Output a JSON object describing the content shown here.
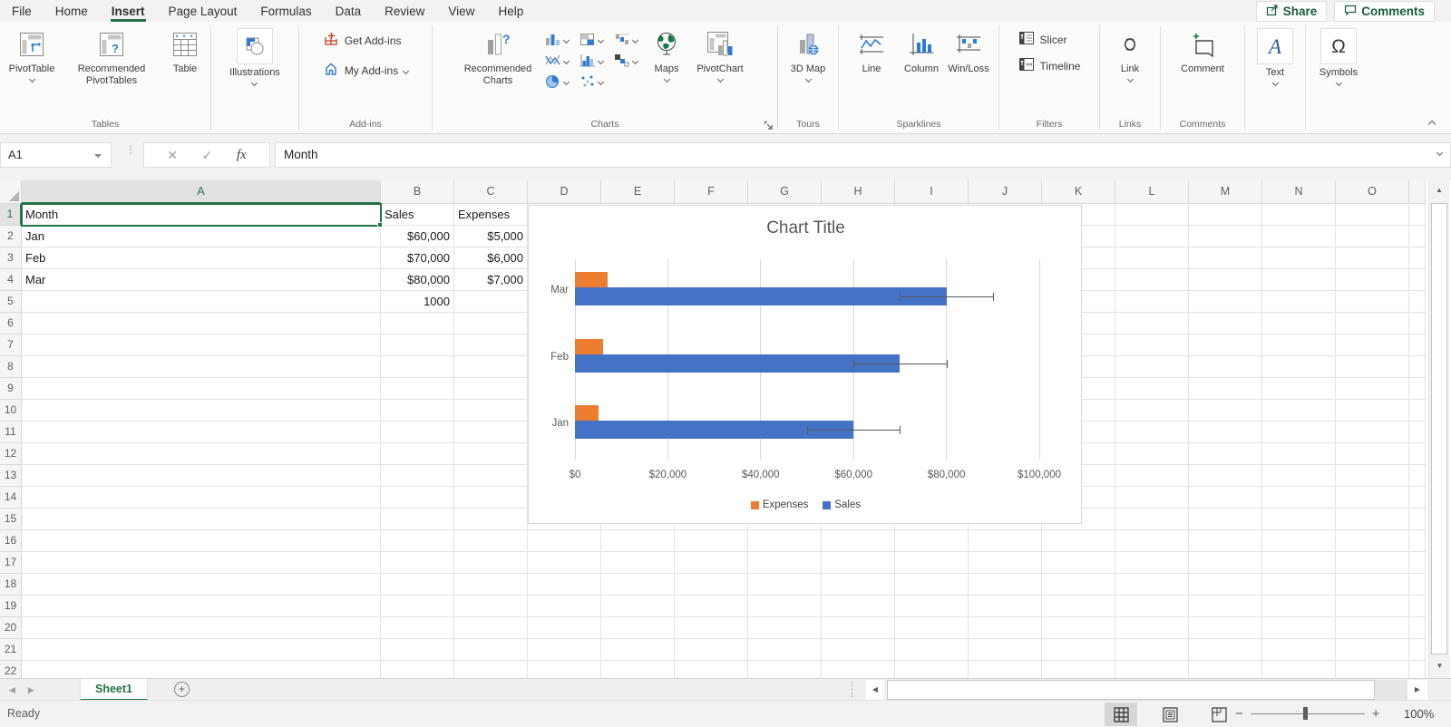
{
  "menu": {
    "tabs": [
      "File",
      "Home",
      "Insert",
      "Page Layout",
      "Formulas",
      "Data",
      "Review",
      "View",
      "Help"
    ],
    "active_tab": "Insert",
    "share": "Share",
    "comments_btn": "Comments",
    "accent_color": "#217346"
  },
  "ribbon": {
    "tables": {
      "caption": "Tables",
      "pivottable": "PivotTable",
      "recommended_pivottables": "Recommended PivotTables",
      "table": "Table"
    },
    "illustrations": {
      "button": "Illustrations"
    },
    "addins": {
      "caption": "Add-ins",
      "get_addins": "Get Add-ins",
      "my_addins": "My Add-ins"
    },
    "charts": {
      "caption": "Charts",
      "recommended_charts": "Recommended Charts",
      "maps": "Maps",
      "pivotchart": "PivotChart"
    },
    "tours": {
      "caption": "Tours",
      "map3d": "3D Map"
    },
    "sparklines": {
      "caption": "Sparklines",
      "line": "Line",
      "column": "Column",
      "winloss": "Win/Loss"
    },
    "filters": {
      "caption": "Filters",
      "slicer": "Slicer",
      "timeline": "Timeline"
    },
    "links": {
      "caption": "Links",
      "link": "Link"
    },
    "comments": {
      "caption": "Comments",
      "comment": "Comment"
    },
    "text": {
      "button": "Text"
    },
    "symbols": {
      "button": "Symbols"
    }
  },
  "formula_bar": {
    "name_box": "A1",
    "fx": "fx",
    "value": "Month"
  },
  "grid": {
    "columns": [
      "A",
      "B",
      "C",
      "D",
      "E",
      "F",
      "G",
      "H",
      "I",
      "J",
      "K",
      "L",
      "M",
      "N",
      "O"
    ],
    "row_numbers": [
      1,
      2,
      3,
      4,
      5,
      6,
      7,
      8,
      9,
      10,
      11,
      12,
      13,
      14,
      15,
      16,
      17,
      18,
      19,
      20,
      21,
      22
    ],
    "selected_cell": "A1",
    "cells": {
      "A1": "Month",
      "B1": "Sales",
      "C1": "Expenses",
      "A2": "Jan",
      "B2": "$60,000",
      "C2": "$5,000",
      "A3": "Feb",
      "B3": "$70,000",
      "C3": "$6,000",
      "A4": "Mar",
      "B4": "$80,000",
      "C4": "$7,000",
      "B5": "1000"
    }
  },
  "chart_data": {
    "type": "bar",
    "orientation": "horizontal",
    "title": "Chart Title",
    "categories": [
      "Jan",
      "Feb",
      "Mar"
    ],
    "category_order_top_to_bottom": [
      "Mar",
      "Feb",
      "Jan"
    ],
    "series": [
      {
        "name": "Sales",
        "color": "#4472C4",
        "values": [
          60000,
          70000,
          80000
        ],
        "error_bars": {
          "plus": 10000,
          "minus": 10000
        }
      },
      {
        "name": "Expenses",
        "color": "#ED7D31",
        "values": [
          5000,
          6000,
          7000
        ]
      }
    ],
    "xlim": [
      0,
      100000
    ],
    "x_tick_labels": [
      "$0",
      "$20,000",
      "$40,000",
      "$60,000",
      "$80,000",
      "$100,000"
    ],
    "gridlines": true,
    "legend_position": "bottom",
    "legend_order": [
      "Expenses",
      "Sales"
    ]
  },
  "sheet_bar": {
    "active_tab": "Sheet1"
  },
  "status_bar": {
    "ready": "Ready",
    "zoom": "100%"
  }
}
